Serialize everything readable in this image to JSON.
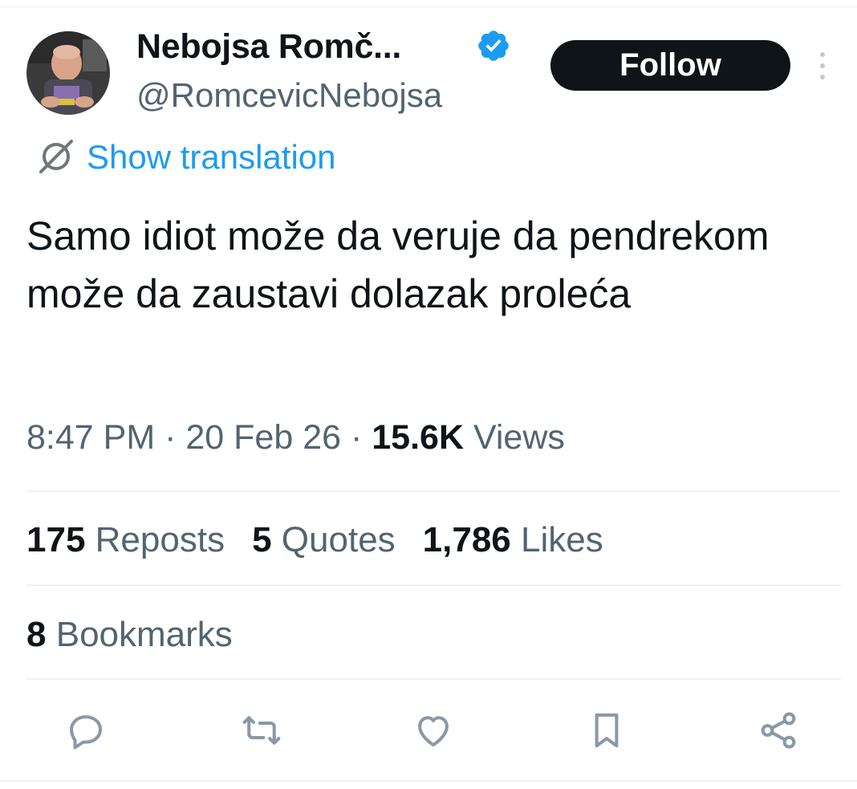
{
  "author": {
    "display_name": "Nebojsa Romč...",
    "handle": "@RomcevicNebojsa",
    "verified_icon": "verified-badge-icon",
    "avatar": "profile-photo"
  },
  "header": {
    "follow_label": "Follow",
    "more_icon": "more-vertical-icon"
  },
  "translation": {
    "label": "Show translation",
    "icon": "translate-icon"
  },
  "tweet": {
    "text": "Samo idiot može da veruje da pendrekom može da zaustavi dolazak proleća"
  },
  "meta": {
    "time": "8:47 PM",
    "separator": "·",
    "date": "20 Feb 26",
    "views_count": "15.6K",
    "views_label": "Views"
  },
  "stats": {
    "reposts_count": "175",
    "reposts_label": "Reposts",
    "quotes_count": "5",
    "quotes_label": "Quotes",
    "likes_count": "1,786",
    "likes_label": "Likes",
    "bookmarks_count": "8",
    "bookmarks_label": "Bookmarks"
  },
  "actions": [
    "reply-icon",
    "repost-icon",
    "like-icon",
    "bookmark-icon",
    "share-icon"
  ],
  "colors": {
    "text_primary": "#0f1419",
    "text_secondary": "#536471",
    "accent_blue": "#1d9bf0",
    "divider": "#eff3f4",
    "follow_bg": "#0f1419"
  }
}
